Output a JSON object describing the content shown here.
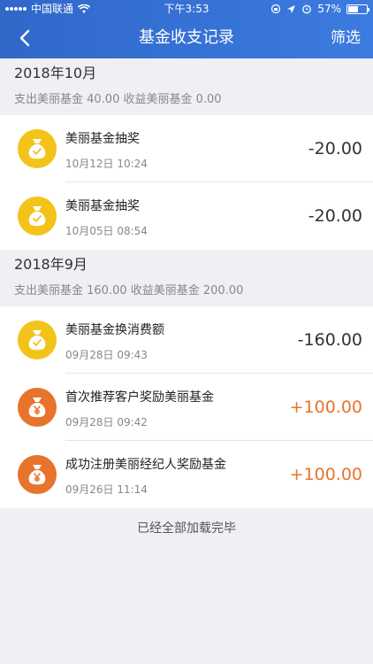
{
  "status_bar": {
    "carrier": "中国联通",
    "time": "下午3:53",
    "battery": "57%",
    "battery_level": 0.57
  },
  "header": {
    "title": "基金收支记录",
    "filter_label": "筛选"
  },
  "sections": [
    {
      "month": "2018年10月",
      "summary": "支出美丽基金 40.00  收益美丽基金 0.00",
      "items": [
        {
          "title": "美丽基金抽奖",
          "time": "10月12日 10:24",
          "amount": "-20.00",
          "kind": "expense"
        },
        {
          "title": "美丽基金抽奖",
          "time": "10月05日 08:54",
          "amount": "-20.00",
          "kind": "expense"
        }
      ]
    },
    {
      "month": "2018年9月",
      "summary": "支出美丽基金 160.00  收益美丽基金 200.00",
      "items": [
        {
          "title": "美丽基金换消费额",
          "time": "09月28日 09:43",
          "amount": "-160.00",
          "kind": "expense"
        },
        {
          "title": "首次推荐客户奖励美丽基金",
          "time": "09月28日 09:42",
          "amount": "+100.00",
          "kind": "income"
        },
        {
          "title": "成功注册美丽经纪人奖励基金",
          "time": "09月26日 11:14",
          "amount": "+100.00",
          "kind": "income"
        }
      ]
    }
  ],
  "footer": {
    "text": "已经全部加载完毕"
  },
  "colors": {
    "nav_blue": "#3a76d8",
    "expense_icon": "#f3c31a",
    "income_icon": "#e8732c",
    "income_amount": "#e8732c"
  },
  "icons": {
    "expense": "yellow-money-bag-check-icon",
    "income": "orange-money-bag-yen-icon"
  }
}
